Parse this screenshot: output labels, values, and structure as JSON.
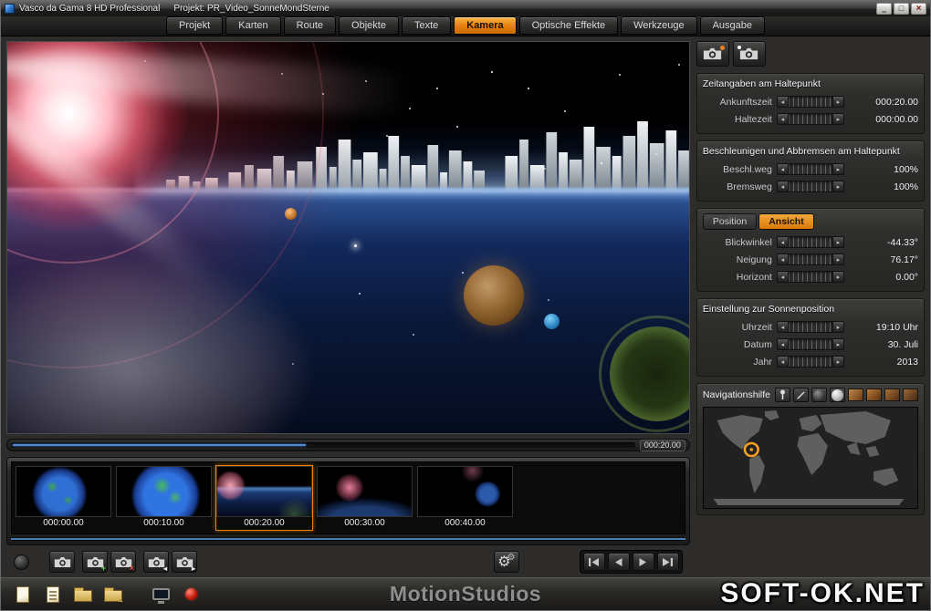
{
  "colors": {
    "accent": "#e8820c",
    "progress_blue": "#4a7fb5",
    "selection": "#e8820c"
  },
  "titlebar": {
    "app_title": "Vasco da Gama 8 HD Professional",
    "project": "Projekt: PR_Video_SonneMondSterne"
  },
  "menu": {
    "tabs": [
      {
        "label": "Projekt",
        "active": false
      },
      {
        "label": "Karten",
        "active": false
      },
      {
        "label": "Route",
        "active": false
      },
      {
        "label": "Objekte",
        "active": false
      },
      {
        "label": "Texte",
        "active": false
      },
      {
        "label": "Kamera",
        "active": true
      },
      {
        "label": "Optische Effekte",
        "active": false
      },
      {
        "label": "Werkzeuge",
        "active": false
      },
      {
        "label": "Ausgabe",
        "active": false
      }
    ]
  },
  "panels": {
    "time": {
      "title": "Zeitangaben am Haltepunkt",
      "rows": [
        {
          "label": "Ankunftszeit",
          "value": "000:20.00"
        },
        {
          "label": "Haltezeit",
          "value": "000:00.00"
        }
      ]
    },
    "accel": {
      "title": "Beschleunigen und Abbremsen am Haltepunkt",
      "rows": [
        {
          "label": "Beschl.weg",
          "value": "100%"
        },
        {
          "label": "Bremsweg",
          "value": "100%"
        }
      ]
    },
    "view": {
      "tabs": [
        {
          "label": "Position",
          "active": false
        },
        {
          "label": "Ansicht",
          "active": true
        }
      ],
      "rows": [
        {
          "label": "Blickwinkel",
          "value": "-44.33°"
        },
        {
          "label": "Neigung",
          "value": "76.17°"
        },
        {
          "label": "Horizont",
          "value": "0.00°"
        }
      ]
    },
    "sun": {
      "title": "Einstellung zur Sonnenposition",
      "rows": [
        {
          "label": "Uhrzeit",
          "value": "19:10 Uhr"
        },
        {
          "label": "Datum",
          "value": "30. Juli"
        },
        {
          "label": "Jahr",
          "value": "2013"
        }
      ]
    },
    "nav": {
      "title": "Navigationshilfe"
    }
  },
  "scrubber": {
    "time": "000:20.00",
    "progress_pct": 47
  },
  "timeline": {
    "clips": [
      {
        "time": "000:00.00",
        "selected": false
      },
      {
        "time": "000:10.00",
        "selected": false
      },
      {
        "time": "000:20.00",
        "selected": true
      },
      {
        "time": "000:30.00",
        "selected": false
      },
      {
        "time": "000:40.00",
        "selected": false
      }
    ]
  },
  "branding": {
    "logo": "MotionStudios",
    "watermark": "SOFT-OK.NET"
  }
}
